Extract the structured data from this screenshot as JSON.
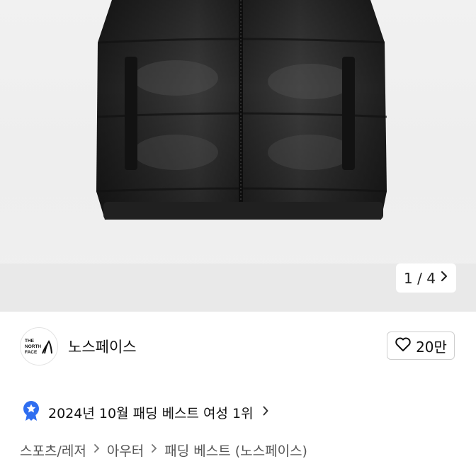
{
  "gallery": {
    "counter": "1 / 4",
    "next_icon": "chevron-right-icon"
  },
  "brand": {
    "logo_text": [
      "THE",
      "NORTH",
      "FACE"
    ],
    "name": "노스페이스",
    "like_icon": "heart-icon",
    "like_count": "20만"
  },
  "ranking": {
    "badge_icon": "star-badge-icon",
    "badge_color": "#2f6ef0",
    "text": "2024년 10월 패딩 베스트 여성 1위"
  },
  "breadcrumb": {
    "items": [
      "스포츠/레저",
      "아우터",
      "패딩 베스트 (노스페이스)"
    ]
  }
}
